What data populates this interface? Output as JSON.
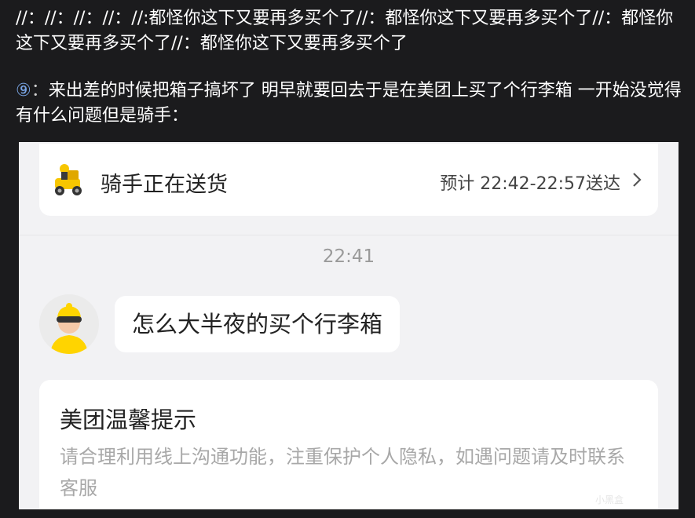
{
  "post": {
    "repost_text": "//：//：//：//：//:都怪你这下又要再多买个了//：都怪你这下又要再多买个了//：都怪你这下又要再多买个了//：都怪你这下又要再多买个了",
    "item_number": "⑨",
    "item_separator": "：",
    "item_text": "来出差的时候把箱子搞坏了 明早就要回去于是在美团上买了个行李箱 一开始没觉得有什么问题但是骑手："
  },
  "screenshot": {
    "delivery": {
      "status": "骑手正在送货",
      "eta": "预计 22:42-22:57送达",
      "icon": "rider-scooter-icon"
    },
    "chat": {
      "time": "22:41",
      "message": "怎么大半夜的买个行李箱"
    },
    "tips": {
      "title": "美团温馨提示",
      "body": "请合理利用线上沟通功能，注重保护个人隐私，如遇问题请及时联系客服"
    }
  },
  "watermark": "小黑盒"
}
